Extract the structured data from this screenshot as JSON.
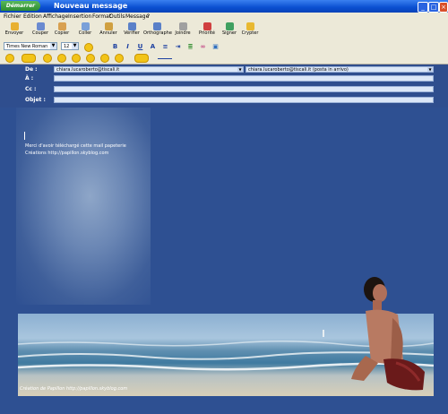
{
  "window": {
    "start_label": "Démarrer",
    "title": "Nouveau message"
  },
  "menu": [
    "Fichier",
    "Edition",
    "Affichage",
    "Insertion",
    "Format",
    "Outils",
    "Message",
    "?"
  ],
  "toolbar": [
    {
      "label": "Envoyer",
      "icon": "send-icon"
    },
    {
      "label": "Couper",
      "icon": "cut-icon"
    },
    {
      "label": "Copier",
      "icon": "copy-icon"
    },
    {
      "label": "Coller",
      "icon": "paste-icon"
    },
    {
      "label": "Annuler",
      "icon": "undo-icon"
    },
    {
      "label": "Vérifier",
      "icon": "check-names-icon"
    },
    {
      "label": "Orthographe",
      "icon": "spelling-icon"
    },
    {
      "label": "Joindre",
      "icon": "attach-icon"
    },
    {
      "label": "Priorité",
      "icon": "priority-icon"
    },
    {
      "label": "Signer",
      "icon": "sign-icon"
    },
    {
      "label": "Crypter",
      "icon": "encrypt-icon"
    }
  ],
  "format": {
    "font": "Times New Roman",
    "size": "12",
    "bold": "B",
    "italic": "I",
    "underline": "U",
    "color": "A"
  },
  "header": {
    "de_label": "De :",
    "de_value": "chiara.lucaroberto@tiscali.it",
    "de_account": "chiara.lucaroberto@tiscali.it (posta in arrivo)",
    "a_label": "À :",
    "cc_label": "Cc :",
    "objet_label": "Objet :"
  },
  "body": {
    "line1": "Merci d'avoir téléchargé cette mail papeterie",
    "line2": "Créations http://papillon.skyblog.com",
    "credit": "Création de Papillon http://papillon.skyblog.com"
  },
  "colors": {
    "titlebar": "#0a4fd1",
    "body_bg": "#2e5092"
  }
}
